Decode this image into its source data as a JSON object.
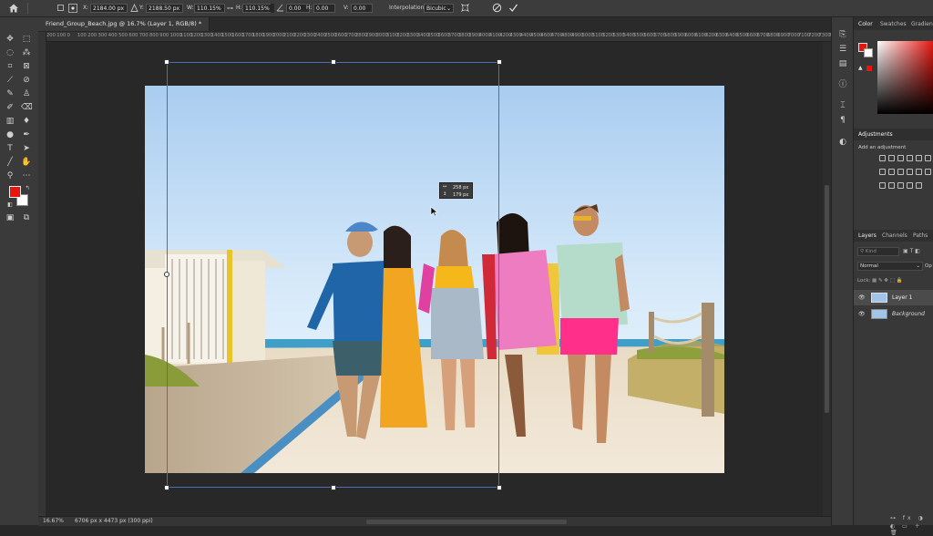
{
  "options_bar": {
    "x_label": "X:",
    "x_value": "2184.00 px",
    "y_label": "Y:",
    "y_value": "2188.50 px",
    "w_label": "W:",
    "w_value": "110.15%",
    "h_label": "H:",
    "h_value": "110.15%",
    "angle_value": "0.00",
    "hskew_label": "H:",
    "hskew_value": "0.00",
    "vskew_label": "V:",
    "vskew_value": "0.00",
    "interp_label": "Interpolation:",
    "interp_value": "Bicubic"
  },
  "document": {
    "tab_title": "Friend_Group_Beach.jpg @ 16.7% (Layer 1, RGB/8) *"
  },
  "ruler_ticks": [
    "200",
    "100",
    "0",
    "100",
    "200",
    "300",
    "400",
    "500",
    "600",
    "700",
    "800",
    "900",
    "1000",
    "1100",
    "1200",
    "1300",
    "1400",
    "1500",
    "1600",
    "1700",
    "1800",
    "1900",
    "2000",
    "2100",
    "2200",
    "2300",
    "2400",
    "2500",
    "2600",
    "2700",
    "2800",
    "2900",
    "3000",
    "3100",
    "3200",
    "3300",
    "3400",
    "3500",
    "3600",
    "3700",
    "3800",
    "3900",
    "4000",
    "4100",
    "4200",
    "4300",
    "4400",
    "4500",
    "4600",
    "4700",
    "4800",
    "4900",
    "5000",
    "5100",
    "5200",
    "5300",
    "5400",
    "5500",
    "5600",
    "5700",
    "5800",
    "5900",
    "6000",
    "6100",
    "6200",
    "6300",
    "6400",
    "6500",
    "6600",
    "6700",
    "6800",
    "6900",
    "7000",
    "7100",
    "7200",
    "7300",
    "7400",
    "7500"
  ],
  "transform_tooltip": {
    "line1": "258 px",
    "line2": "179 px"
  },
  "status": {
    "zoom": "16.67%",
    "doc_size": "6706 px x 4473 px (300 ppi)"
  },
  "panels": {
    "color_tab": "Color",
    "swatches_tab": "Swatches",
    "gradients_tab": "Gradien",
    "adjustments_title": "Adjustments",
    "adjustments_hint": "Add an adjustment",
    "layers_tab": "Layers",
    "channels_tab": "Channels",
    "paths_tab": "Paths",
    "kind_placeholder": "Kind",
    "blend_mode": "Normal",
    "opacity_label": "Op",
    "lock_label": "Lock:",
    "layers": [
      {
        "name": "Layer 1"
      },
      {
        "name": "Background"
      }
    ]
  },
  "colors": {
    "foreground": "#e8150f",
    "background": "#ffffff",
    "accent": "#4a6fb5"
  }
}
